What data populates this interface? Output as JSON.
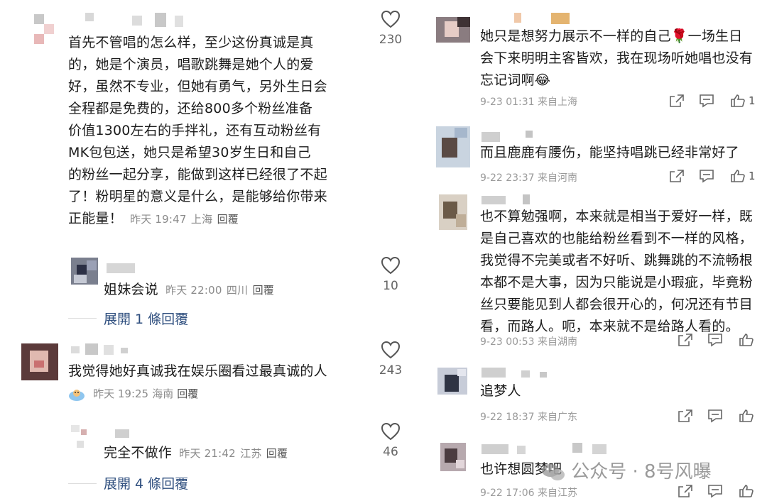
{
  "left": {
    "comments": [
      {
        "text_lines": [
          "首先不管唱的怎么样，至少这份真诚是真",
          "的，她是个演员，唱歌跳舞是她个人的爱",
          "好，虽然不专业，但她有勇气，另外生日会",
          "全程都是免费的，还给800多个粉丝准备",
          "价值1300左右的手拌礼，还有互动粉丝有",
          "MK包包送，她只是希望30岁生日和自己",
          "的粉丝一起分享，能做到这样已经很了不起",
          "了！粉明星的意义是什么，是能够给你带来"
        ],
        "last_line": "正能量！",
        "time": "昨天 19:47",
        "location": "上海",
        "reply": "回覆",
        "likes": "230"
      },
      {
        "text": "姐妹会说",
        "time": "昨天 22:00",
        "location": "四川",
        "reply": "回覆",
        "likes": "10",
        "expand": "展開 1 條回覆"
      },
      {
        "text": "我觉得她好真诚我在娱乐圈看过最真诚的人",
        "time": "昨天 19:25",
        "location": "海南",
        "reply": "回覆",
        "likes": "243"
      },
      {
        "text": "完全不做作",
        "time": "昨天 21:42",
        "location": "江苏",
        "reply": "回覆",
        "likes": "46",
        "expand": "展開 4 條回覆"
      }
    ]
  },
  "right": {
    "comments": [
      {
        "text_lines": [
          "她只是想努力展示不一样的自己🌹一场生日",
          "会下来明明主客皆欢，我在现场听她唱也没有",
          "忘记词啊😂"
        ],
        "date": "9-23 01:31",
        "location": "来自上海",
        "likes": "1"
      },
      {
        "text_lines": [
          "而且鹿鹿有腰伤，能坚持唱跳已经非常好了"
        ],
        "date": "9-22 23:37",
        "location": "来自河南",
        "likes": "1"
      },
      {
        "text_lines": [
          "也不算勉强啊，本来就是相当于爱好一样，既",
          "是自己喜欢的也能给粉丝看到不一样的风格，",
          "我觉得不完美或者不好听、跳舞跳的不流畅根",
          "本都不是大事，因为只能说是小瑕疵，毕竟粉",
          "丝只要能见到人都会很开心的，何况还有节目",
          "看，而路人。呃，本来就不是给路人看的。"
        ],
        "date": "9-23 00:53",
        "location": "来自湖南"
      },
      {
        "text_lines": [
          "追梦人"
        ],
        "date": "9-22 18:37",
        "location": "来自广东"
      },
      {
        "text_lines": [
          "也许想圆梦吧"
        ],
        "date": "9-22 17:06",
        "location": "来自江苏"
      }
    ],
    "watermark": "公众号 · 8号风曝"
  }
}
